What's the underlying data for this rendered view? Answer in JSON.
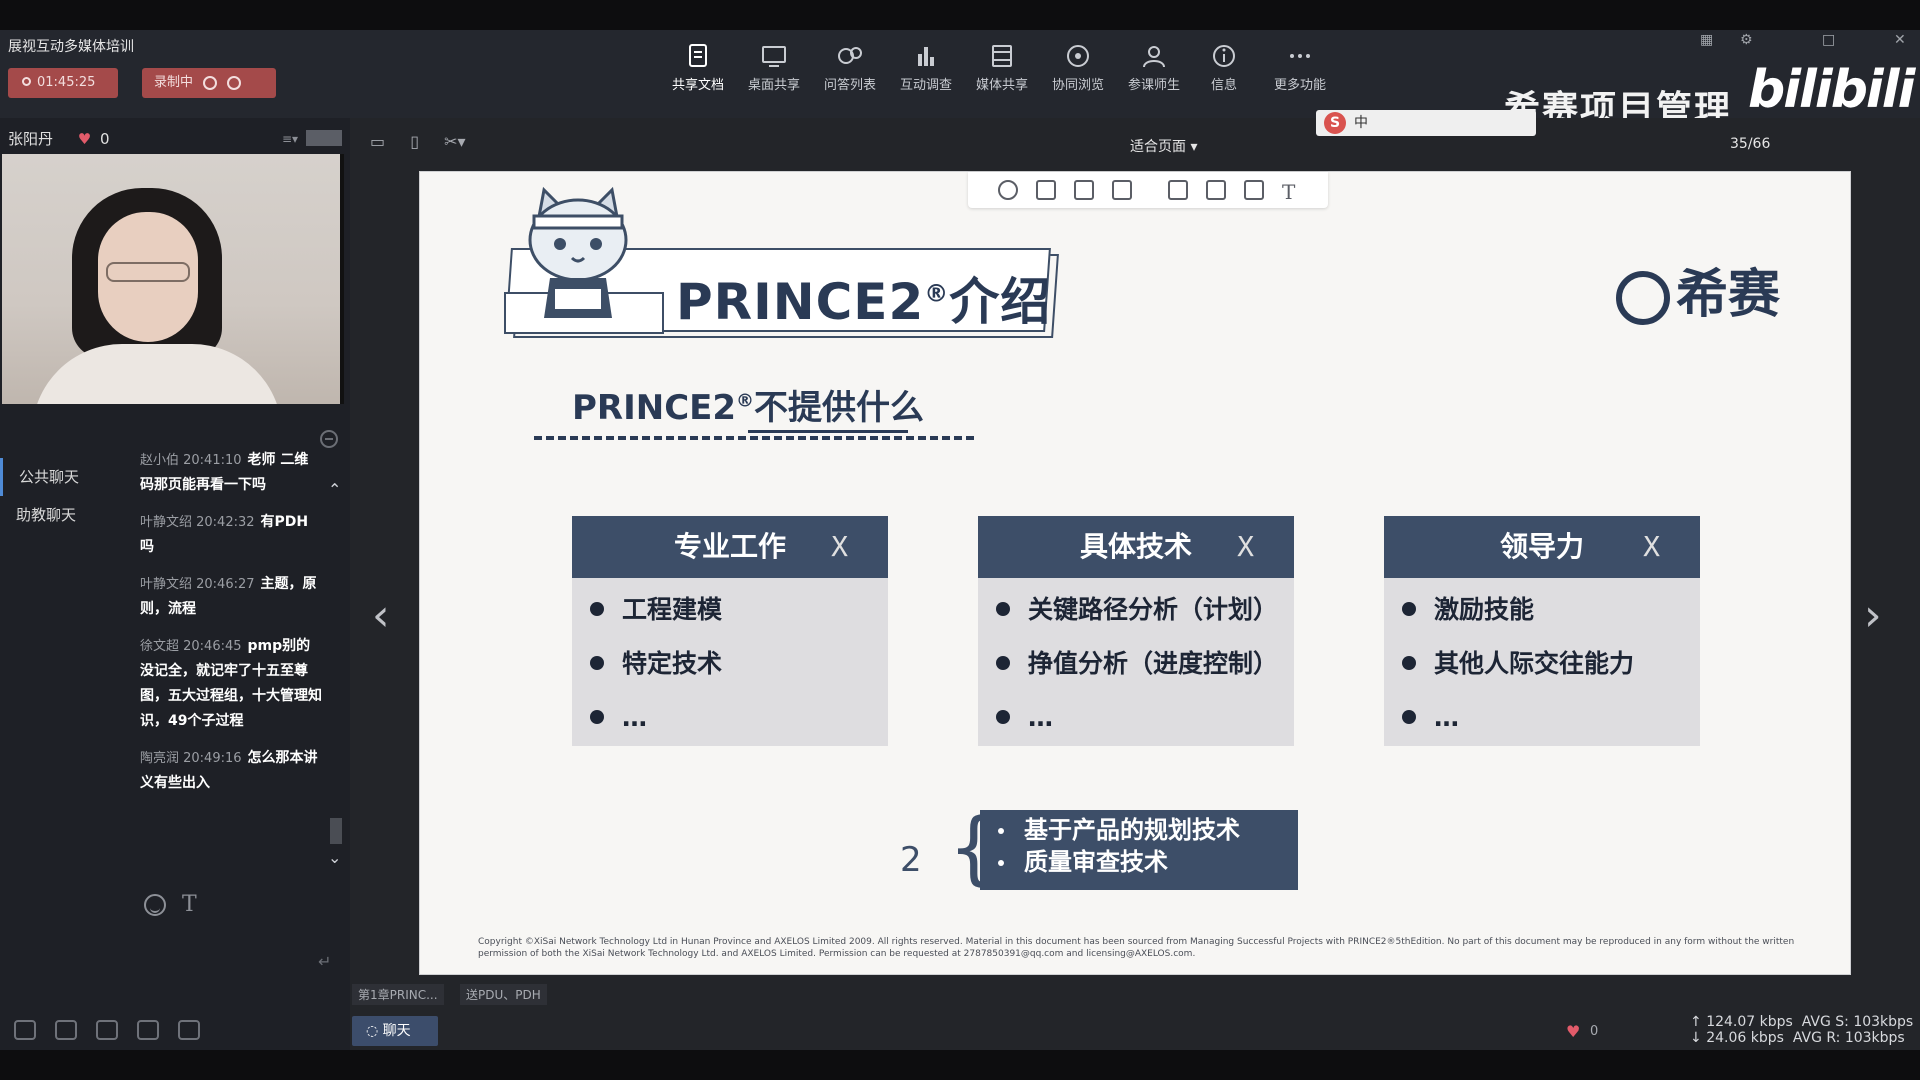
{
  "app": {
    "title": "展视互动多媒体培训",
    "timer": "01:45:25",
    "recording": "录制中"
  },
  "toolbar": {
    "items": [
      {
        "label": "共享文档",
        "icon": "document-share-icon"
      },
      {
        "label": "桌面共享",
        "icon": "desktop-share-icon"
      },
      {
        "label": "问答列表",
        "icon": "qa-list-icon"
      },
      {
        "label": "互动调查",
        "icon": "bar-chart-icon"
      },
      {
        "label": "媒体共享",
        "icon": "media-share-icon"
      },
      {
        "label": "协同浏览",
        "icon": "compass-icon"
      },
      {
        "label": "参课师生",
        "icon": "users-icon"
      },
      {
        "label": "信息",
        "icon": "info-icon"
      },
      {
        "label": "更多功能",
        "icon": "more-icon"
      }
    ]
  },
  "brand": {
    "name": "希赛项目管理",
    "site": "bilibili"
  },
  "left": {
    "presenter": "张阳丹",
    "likes": "0",
    "tabs": [
      "公共聊天",
      "助教聊天"
    ],
    "messages": [
      {
        "meta": "赵小伯 20:41:10",
        "text": "老师 二维码那页能再看一下吗"
      },
      {
        "meta": "叶静文绍 20:42:32",
        "text": "有PDH吗"
      },
      {
        "meta": "叶静文绍 20:46:27",
        "text": "主题，原则，流程"
      },
      {
        "meta": "徐文超 20:46:45",
        "text": "pmp别的没记全，就记牢了十五至尊图，五大过程组，十大管理知识，49个子过程"
      },
      {
        "meta": "陶亮润 20:49:16",
        "text": "怎么那本讲义有些出入"
      }
    ]
  },
  "viewer": {
    "fit": "适合页面",
    "page": "35/66",
    "ime": "中"
  },
  "slide": {
    "title": "PRINCE2",
    "title_mark": "®",
    "title_suffix": "介绍",
    "logo": "希赛",
    "subtitle": "PRINCE2",
    "subtitle_mark": "®",
    "subtitle_suffix": "不提供什么",
    "cards": [
      {
        "head": "专业工作",
        "items": [
          "工程建模",
          "特定技术",
          "…"
        ]
      },
      {
        "head": "具体技术",
        "items": [
          "关键路径分析（计划）",
          "挣值分析（进度控制）",
          "…"
        ]
      },
      {
        "head": "领导力",
        "items": [
          "激励技能",
          "其他人际交往能力",
          "…"
        ]
      }
    ],
    "cross_mark": "X",
    "bottom_items": [
      "基于产品的规划技术",
      "质量审查技术"
    ],
    "hand_number": "2",
    "copyright": "Copyright ©XiSai Network Technology Ltd in Hunan Province and AXELOS Limited 2009. All rights reserved. Material in this document has been sourced from Managing Successful Projects with PRINCE2®5thEdition. No part of this document may be reproduced in any form without the written permission of both the XiSai Network Technology Ltd. and AXELOS Limited. Permission can be requested at 2787850391@qq.com and licensing@AXELOS.com."
  },
  "status": {
    "chapter": "第1章PRINC...",
    "chapter2": "送PDU、PDH",
    "chat_button": "聊天",
    "likes": "0",
    "up_rate": "124.07 kbps",
    "down_rate": "24.06 kbps",
    "avg_s": "AVG S: 103kbps",
    "avg_r": "AVG R: 103kbps"
  }
}
